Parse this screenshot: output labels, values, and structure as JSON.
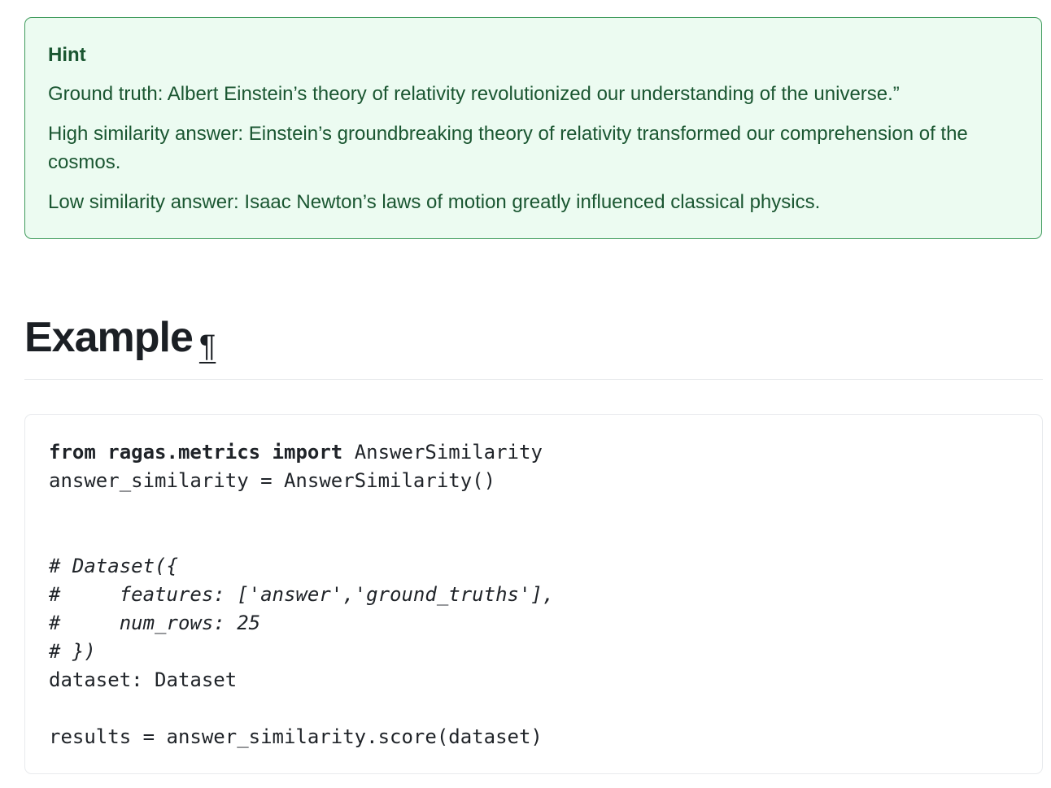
{
  "hint": {
    "title": "Hint",
    "paragraphs": [
      "Ground truth: Albert Einstein’s theory of relativity revolutionized our understanding of the universe.”",
      "High similarity answer: Einstein’s groundbreaking theory of relativity transformed our comprehension of the cosmos.",
      "Low similarity answer: Isaac Newton’s laws of motion greatly influenced classical physics."
    ]
  },
  "section": {
    "heading": "Example",
    "anchor_symbol": "¶"
  },
  "code": {
    "line1_kw_from": "from",
    "line1_module": " ragas.metrics ",
    "line1_kw_import": "import",
    "line1_rest": " AnswerSimilarity",
    "line2": "answer_similarity = AnswerSimilarity()",
    "line3": "",
    "line4": "",
    "line5": "# Dataset({",
    "line6": "#     features: ['answer','ground_truths'],",
    "line7": "#     num_rows: 25",
    "line8": "# })",
    "line9": "dataset: Dataset",
    "line10": "",
    "line11": "results = answer_similarity.score(dataset)"
  }
}
